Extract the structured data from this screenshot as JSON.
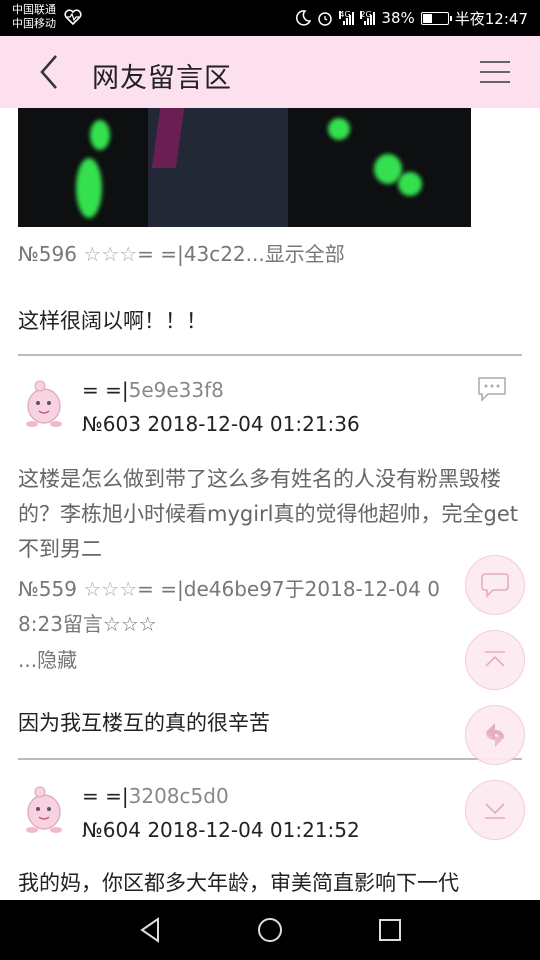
{
  "status_bar": {
    "carrier_1": "中国联通",
    "carrier_2": "中国移动",
    "signal_1_tag": "4G",
    "signal_2_tag": "2G",
    "battery": "38%",
    "time": "半夜12:47"
  },
  "header": {
    "title": "网友留言区",
    "back_icon": "chevron-left-icon",
    "menu_icon": "hamburger-menu-icon",
    "bg_color": "#fde0ee"
  },
  "quote_1": {
    "prefix": "№596 ",
    "stars": "☆☆☆",
    "rest": "= =|43c22...显示全部"
  },
  "reply_1": "这样很阔以啊！！！",
  "comments": [
    {
      "author_prefix": "= =|",
      "author_hash": "5e9e33f8",
      "meta": "№603  2018-12-04 01:21:36",
      "text": "这楼是怎么做到带了这么多有姓名的人没有粉黑毁楼的？李栋旭小时候看mygirl真的觉得他超帅，完全get不到男二",
      "quote_prefix": "№559 ",
      "quote_stars": "☆☆☆",
      "quote_rest": "= =|de46be97于2018-12-04 0",
      "quote_line2": "8:23留言☆☆☆",
      "hidden_label": "...隐藏",
      "reply": "因为我互楼互的真的很辛苦"
    },
    {
      "author_prefix": "= =|",
      "author_hash": "3208c5d0",
      "meta": "№604  2018-12-04 01:21:52",
      "text": "我的妈，你区都多大年龄，审美简直影响下一代"
    }
  ],
  "floating_buttons": [
    "comment-icon",
    "scroll-top-icon",
    "refresh-icon",
    "scroll-bottom-icon"
  ],
  "nav": [
    "back-triangle-icon",
    "home-circle-icon",
    "recents-square-icon"
  ],
  "battery_level": 0.38
}
